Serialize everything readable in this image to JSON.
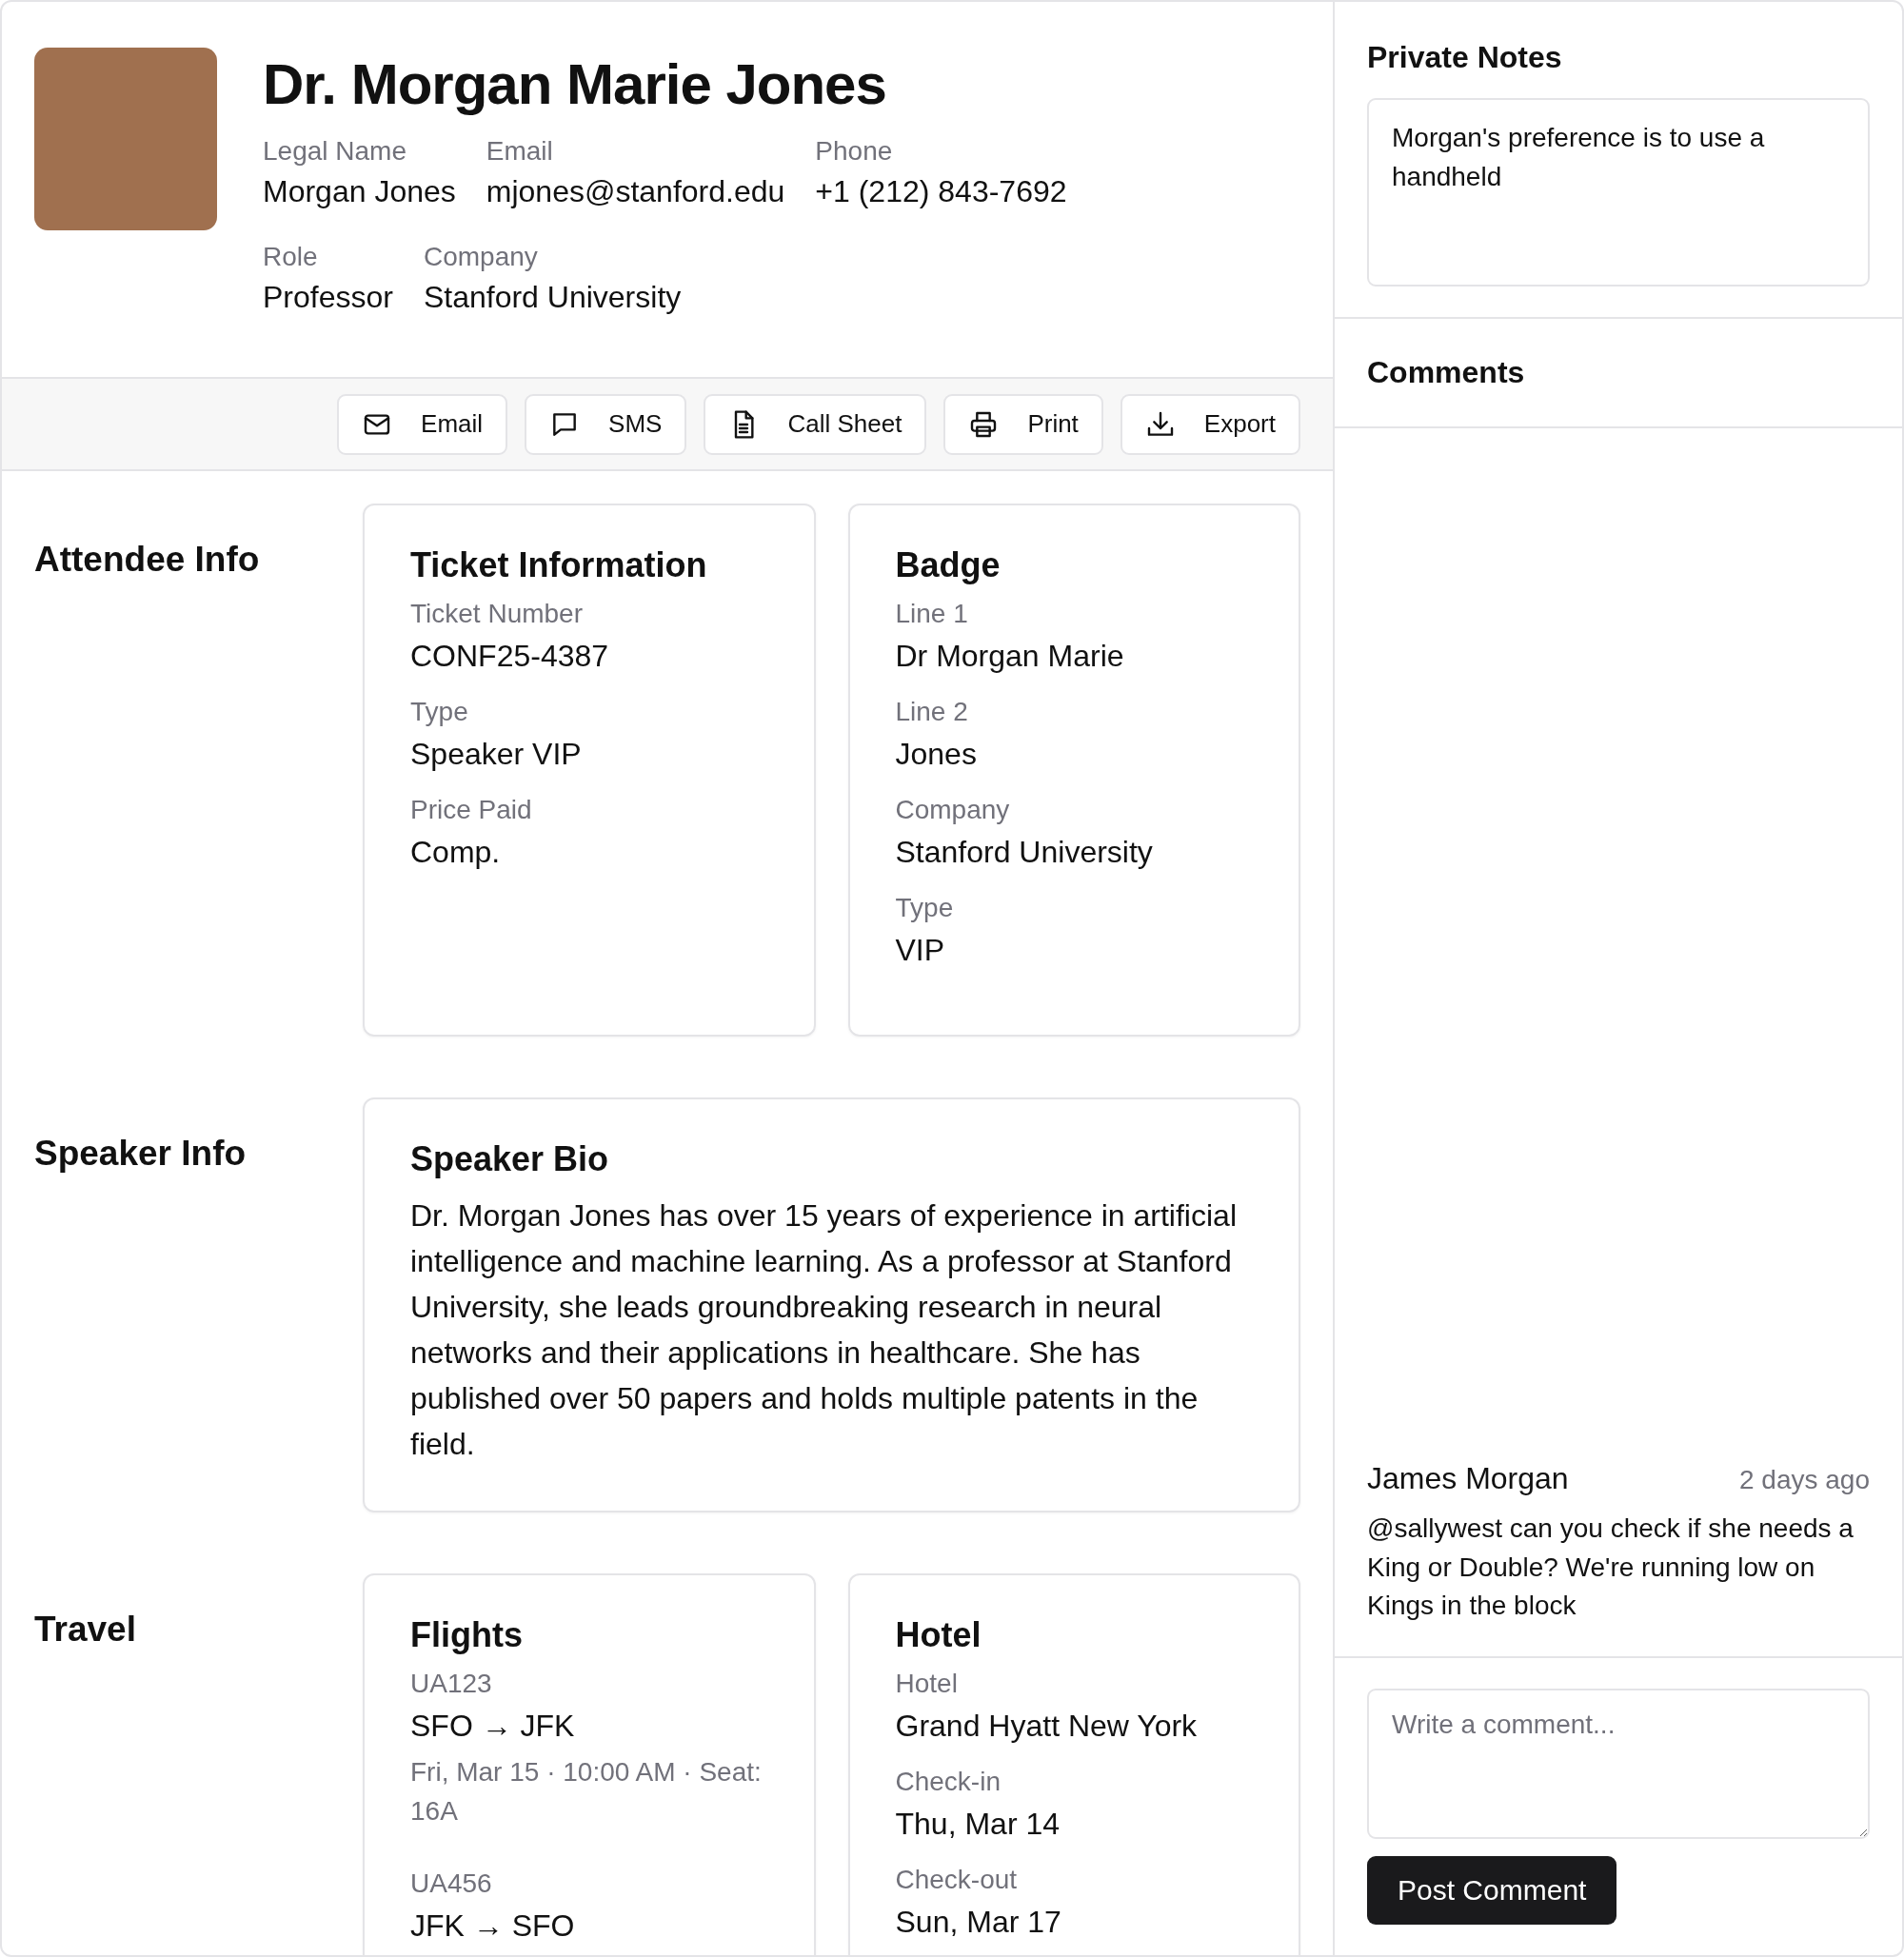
{
  "profile": {
    "name": "Dr. Morgan Marie Jones",
    "rows": [
      [
        {
          "label": "Legal Name",
          "value": "Morgan Jones"
        },
        {
          "label": "Email",
          "value": "mjones@stanford.edu"
        },
        {
          "label": "Phone",
          "value": "+1 (212) 843-7692"
        }
      ],
      [
        {
          "label": "Role",
          "value": "Professor"
        },
        {
          "label": "Company",
          "value": "Stanford University"
        }
      ]
    ]
  },
  "toolbar": [
    {
      "label": "Email",
      "kind": "mail"
    },
    {
      "label": "SMS",
      "kind": "message"
    },
    {
      "label": "Call Sheet",
      "kind": "document"
    },
    {
      "label": "Print",
      "kind": "printer"
    },
    {
      "label": "Export",
      "kind": "download"
    }
  ],
  "sections": [
    {
      "title": "Attendee Info",
      "cards": [
        {
          "kind": "fields",
          "title": "Ticket Information",
          "fields": [
            {
              "label": "Ticket Number",
              "value": "CONF25-4387"
            },
            {
              "label": "Type",
              "value": "Speaker VIP"
            },
            {
              "label": "Price Paid",
              "value": "Comp."
            }
          ]
        },
        {
          "kind": "fields",
          "title": "Badge",
          "fields": [
            {
              "label": "Line 1",
              "value": "Dr Morgan Marie"
            },
            {
              "label": "Line 2",
              "value": "Jones"
            },
            {
              "label": "Company",
              "value": "Stanford University"
            },
            {
              "label": "Type",
              "value": "VIP"
            }
          ]
        }
      ]
    },
    {
      "title": "Speaker Info",
      "cards": [
        {
          "kind": "bio",
          "title": "Speaker Bio",
          "text": "Dr. Morgan Jones has over 15 years of experience in artificial intelligence and machine learning. As a professor at Stanford University, she leads groundbreaking research in neural networks and their applications in healthcare. She has published over 50 papers and holds multiple patents in the field."
        }
      ]
    },
    {
      "title": "Travel",
      "cards": [
        {
          "kind": "flights",
          "title": "Flights",
          "flights": [
            {
              "number": "UA123",
              "route": "SFO → JFK",
              "detail": "Fri, Mar 15 · 10:00 AM · Seat: 16A"
            },
            {
              "number": "UA456",
              "route": "JFK → SFO"
            }
          ]
        },
        {
          "kind": "fields",
          "title": "Hotel",
          "fields": [
            {
              "label": "Hotel",
              "value": "Grand Hyatt New York"
            },
            {
              "label": "Check-in",
              "value": "Thu, Mar 14"
            },
            {
              "label": "Check-out",
              "value": "Sun, Mar 17"
            }
          ]
        }
      ]
    }
  ],
  "notes": {
    "title": "Private Notes",
    "value": "Morgan's preference is to use a handheld"
  },
  "comments": {
    "title": "Comments",
    "items": [
      {
        "author": "James Morgan",
        "time": "2 days ago",
        "text": "@sallywest can you check if she needs a King or Double? We're running low on Kings in the block"
      }
    ],
    "input": {
      "placeholder": "Write a comment..."
    },
    "button": "Post Comment"
  }
}
